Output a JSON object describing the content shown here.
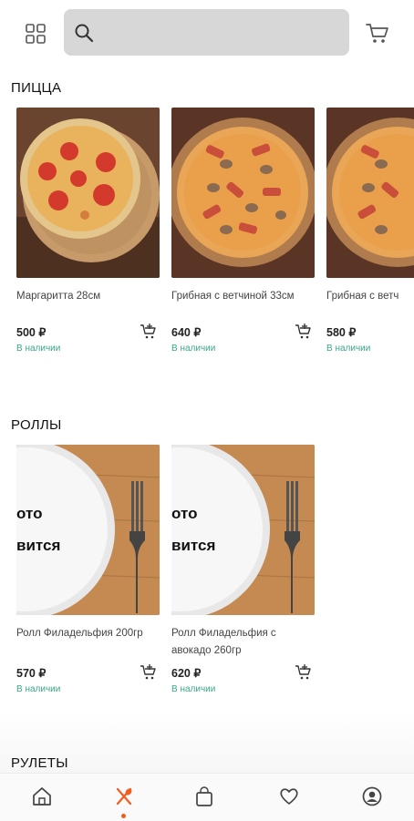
{
  "header": {
    "search": {
      "placeholder": "",
      "value": ""
    },
    "icons": {
      "menu": "grid-icon",
      "search": "search-icon",
      "cart": "cart-icon"
    }
  },
  "sections": [
    {
      "title": "ПИЦЦА",
      "items": [
        {
          "name": "Маргаритта 28см",
          "price": "500 ₽",
          "stock": "В наличии",
          "image": "pizza-margherita"
        },
        {
          "name": "Грибная с ветчиной 33см",
          "price": "640 ₽",
          "stock": "В наличии",
          "image": "pizza-mushroom-ham"
        },
        {
          "name": "Грибная с ветч",
          "price": "580 ₽",
          "stock": "В наличии",
          "image": "pizza-mushroom-ham"
        }
      ]
    },
    {
      "title": "РОЛЛЫ",
      "items": [
        {
          "name": "Ролл Филадельфия 200гр",
          "price": "570 ₽",
          "stock": "В наличии",
          "image": "placeholder-plate",
          "image_text": [
            "ото",
            "вится"
          ]
        },
        {
          "name": "Ролл Филадельфия с авокадо 260гр",
          "price": "620 ₽",
          "stock": "В наличии",
          "image": "placeholder-plate",
          "image_text": [
            "ото",
            "вится"
          ]
        }
      ]
    },
    {
      "title": "РУЛЕТЫ",
      "items": []
    }
  ],
  "bottom_nav": {
    "items": [
      "home-icon",
      "menu-food-icon",
      "bag-icon",
      "heart-icon",
      "profile-icon"
    ],
    "active": "menu-food-icon"
  },
  "colors": {
    "accent": "#f25c1e",
    "stock": "#3aa88a",
    "search_bg": "#d7d7d7"
  }
}
